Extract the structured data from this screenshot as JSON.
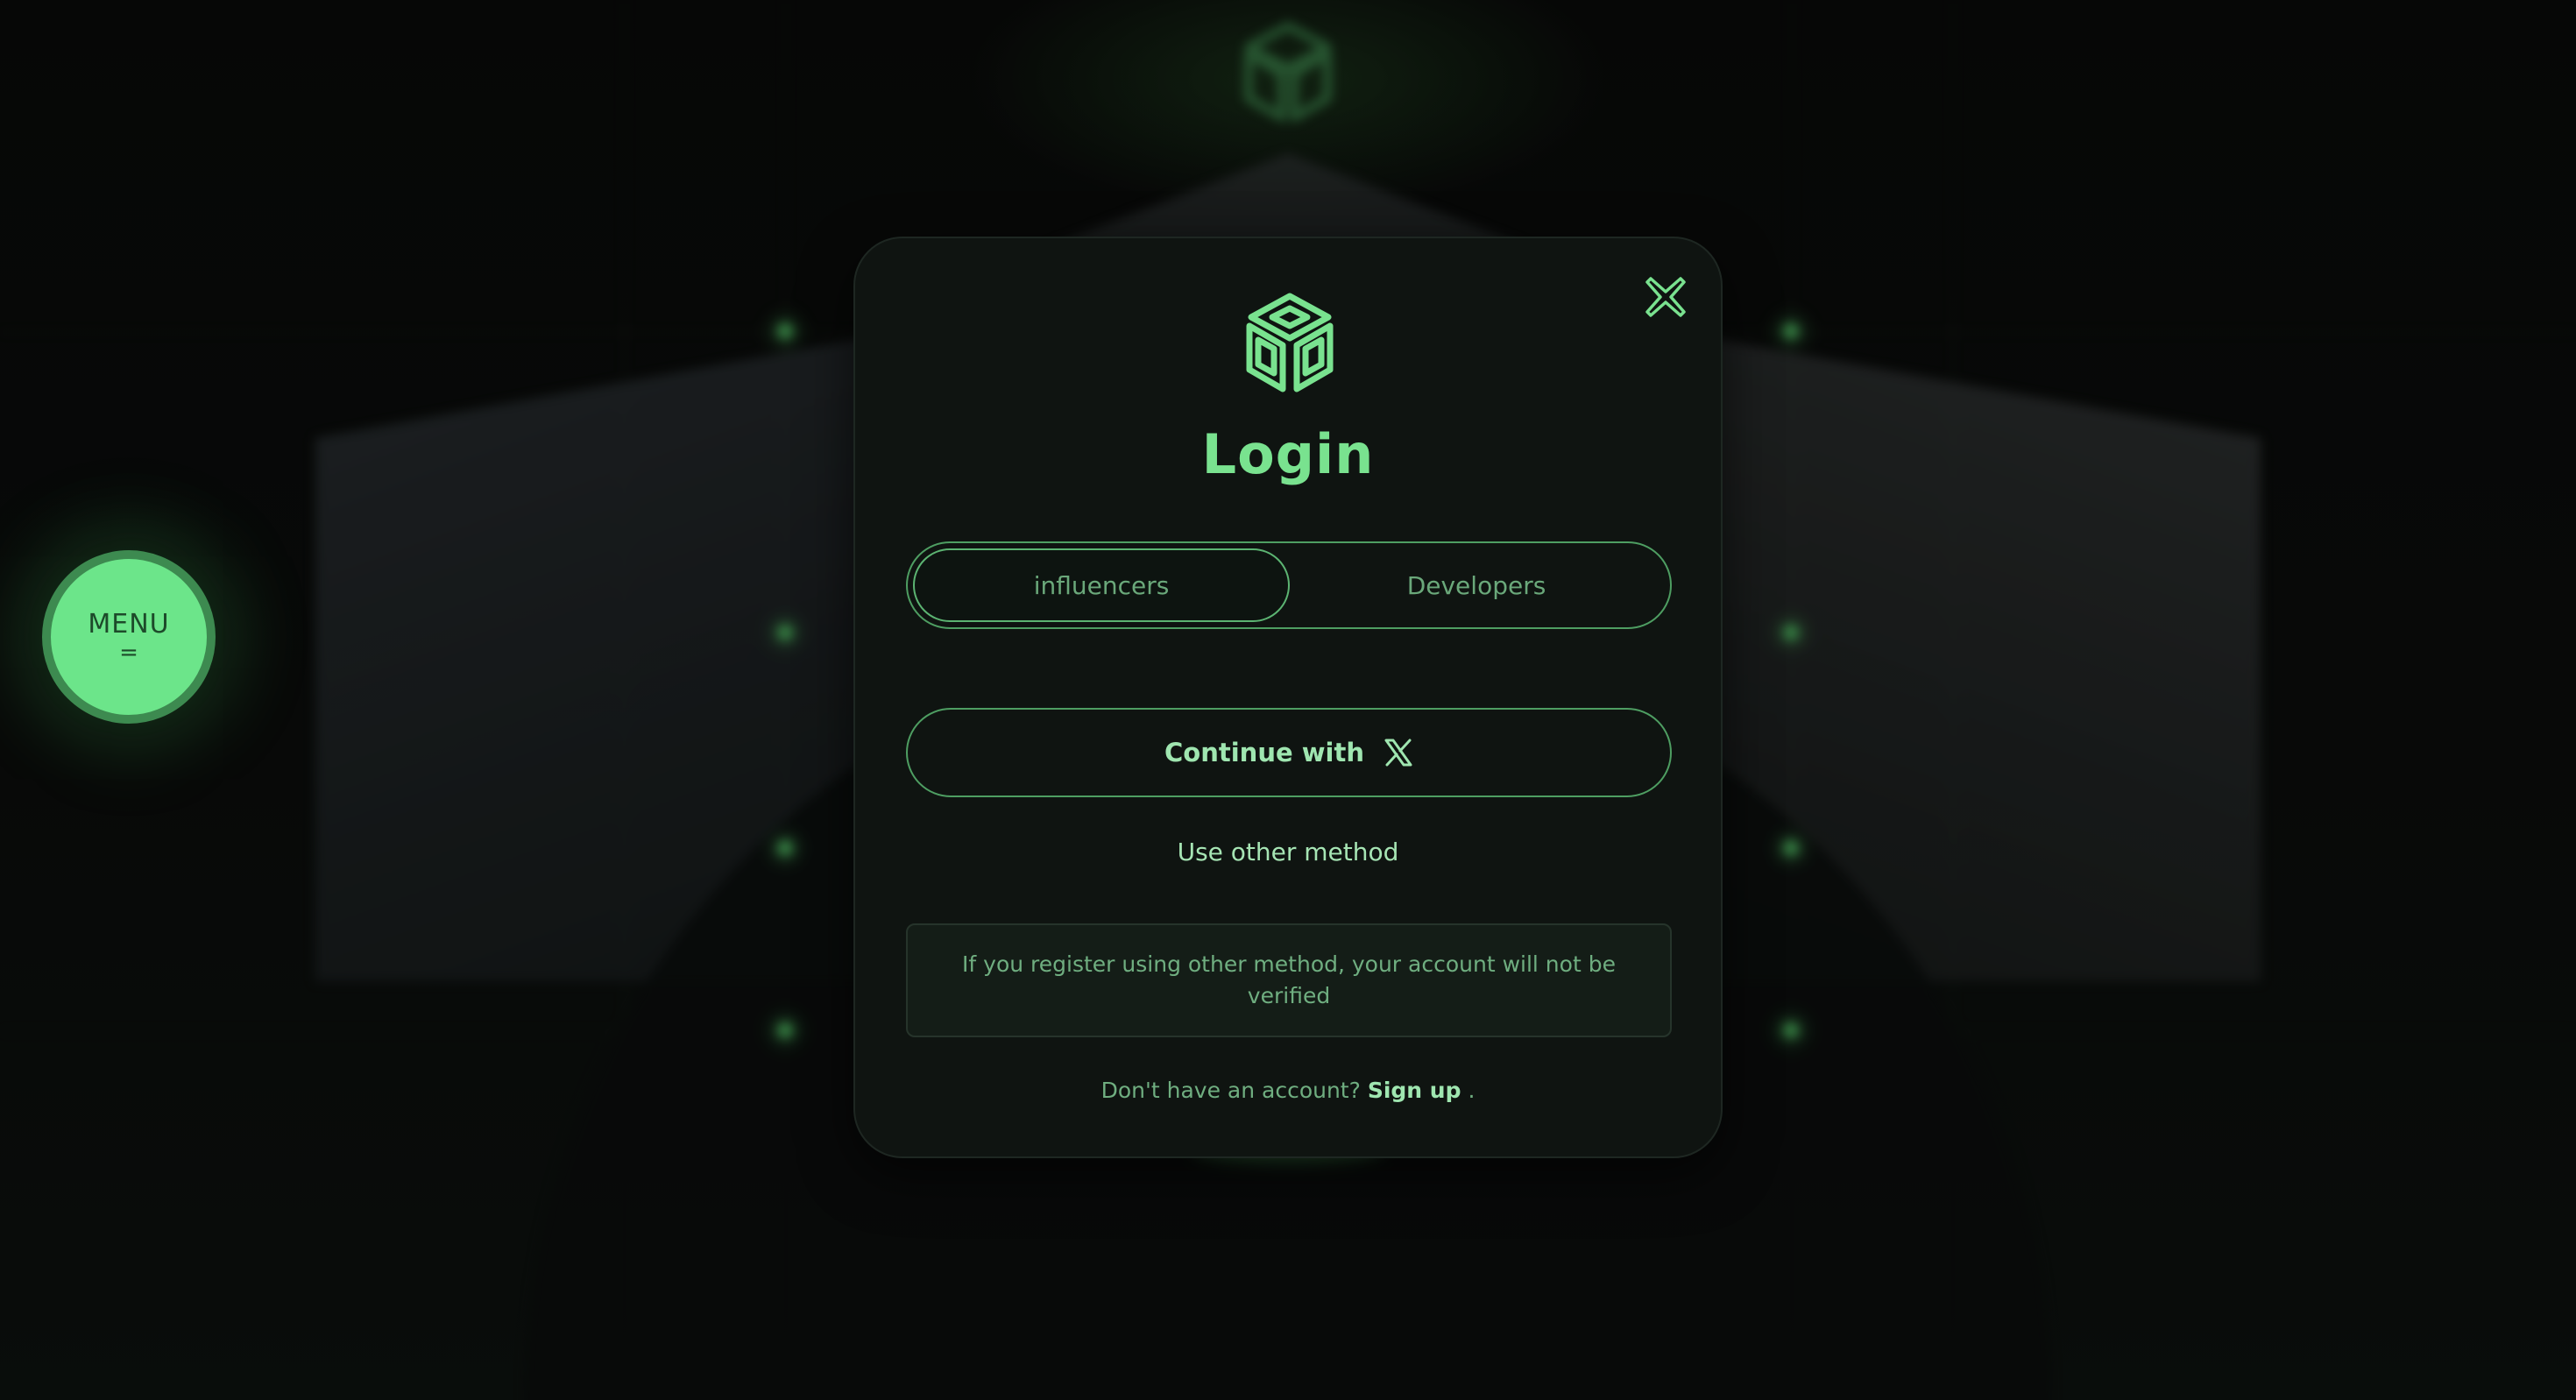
{
  "menu": {
    "label": "MENU",
    "icon_glyph": "="
  },
  "modal": {
    "title": "Login",
    "tabs": [
      {
        "label": "influencers",
        "active": true
      },
      {
        "label": "Developers",
        "active": false
      }
    ],
    "continue_label": "Continue with",
    "other_method": "Use other method",
    "notice": "If you register using other method, your account will not be verified",
    "signup_prompt": "Don't have an account?",
    "signup_link": "Sign up",
    "signup_suffix": " ."
  },
  "icons": {
    "close": "close-icon",
    "logo": "cube-logo-icon",
    "social": "x-logo-icon"
  },
  "colors": {
    "accent": "#79e28f",
    "menu_bg": "#6ce58a",
    "modal_bg": "#0f1411",
    "page_bg": "#0a0b0a"
  }
}
